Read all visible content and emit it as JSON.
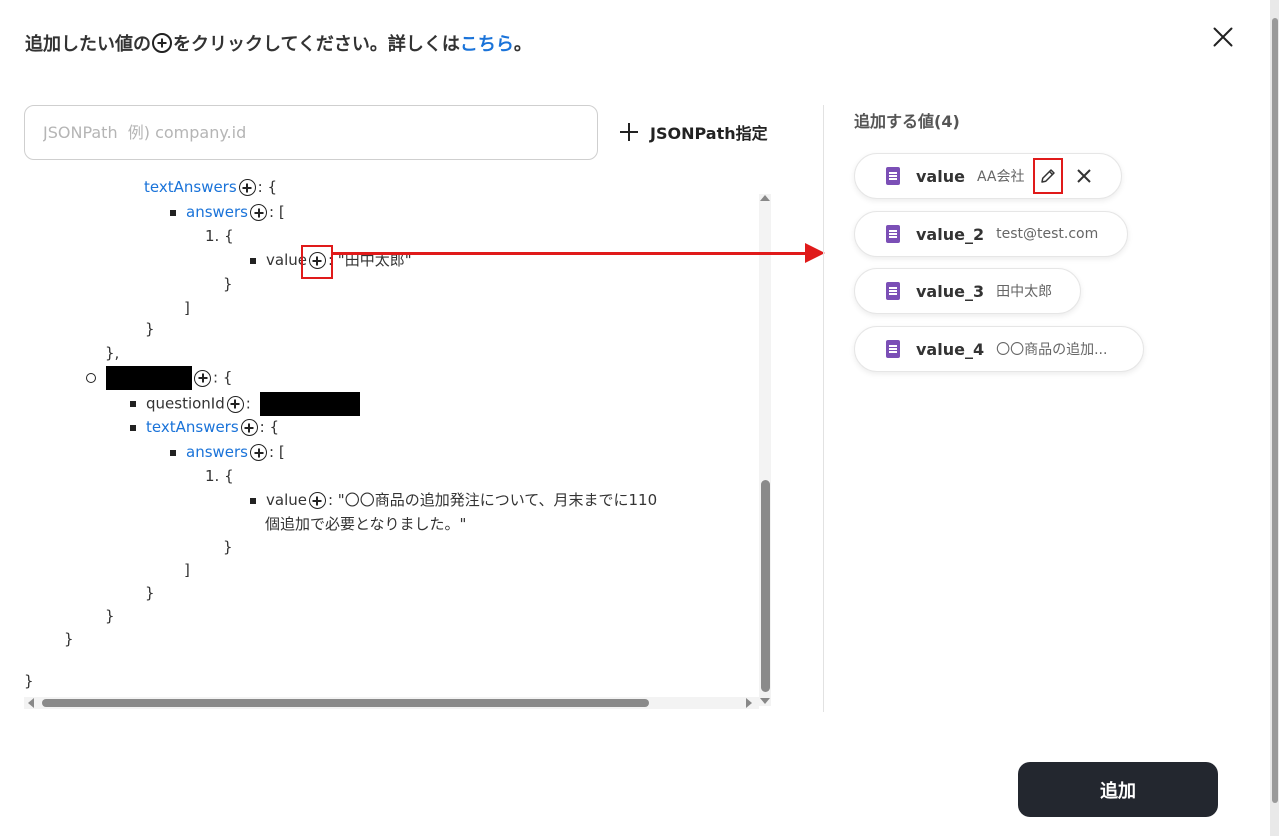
{
  "header": {
    "prefix": "追加したい値の",
    "suffix": "をクリックしてください。詳しくは",
    "link": "こちら",
    "end": "。"
  },
  "search": {
    "placeholder": "JSONPath  例) company.id",
    "value": ""
  },
  "jsonpath_button": {
    "label": "JSONPath指定"
  },
  "tree": {
    "l1_key": "textAnswers",
    "l1_rest": ": {",
    "l2_key": "answers",
    "l2_rest": ": [",
    "l3": "1. {",
    "l4_key": "value",
    "l4_rest": ": \"田中太郎\"",
    "l5": "}",
    "l6": "]",
    "l7": "}",
    "l8": "},",
    "l9_rest": ": {",
    "l10_key": "questionId",
    "l10_rest": ":",
    "l11_key": "textAnswers",
    "l11_rest": ": {",
    "l12_key": "answers",
    "l12_rest": ": [",
    "l13": "1. {",
    "l14_key": "value",
    "l14_rest": ": \"〇〇商品の追加発注について、月末までに110",
    "l15": "個追加で必要となりました。\"",
    "l16": "}",
    "l17": "]",
    "l18": "}",
    "l19": "}",
    "l20": "}",
    "l21": "}"
  },
  "values_panel": {
    "title": "追加する値(4)",
    "items": [
      {
        "name": "value",
        "value": "AA会社"
      },
      {
        "name": "value_2",
        "value": "test@test.com"
      },
      {
        "name": "value_3",
        "value": "田中太郎"
      },
      {
        "name": "value_4",
        "value": "〇〇商品の追加..."
      }
    ]
  },
  "submit": {
    "label": "追加"
  },
  "colors": {
    "accent": "#1a73d9",
    "annotation": "#e01a1a",
    "form_icon": "#7b4fb6",
    "button_dark": "#23272f"
  }
}
